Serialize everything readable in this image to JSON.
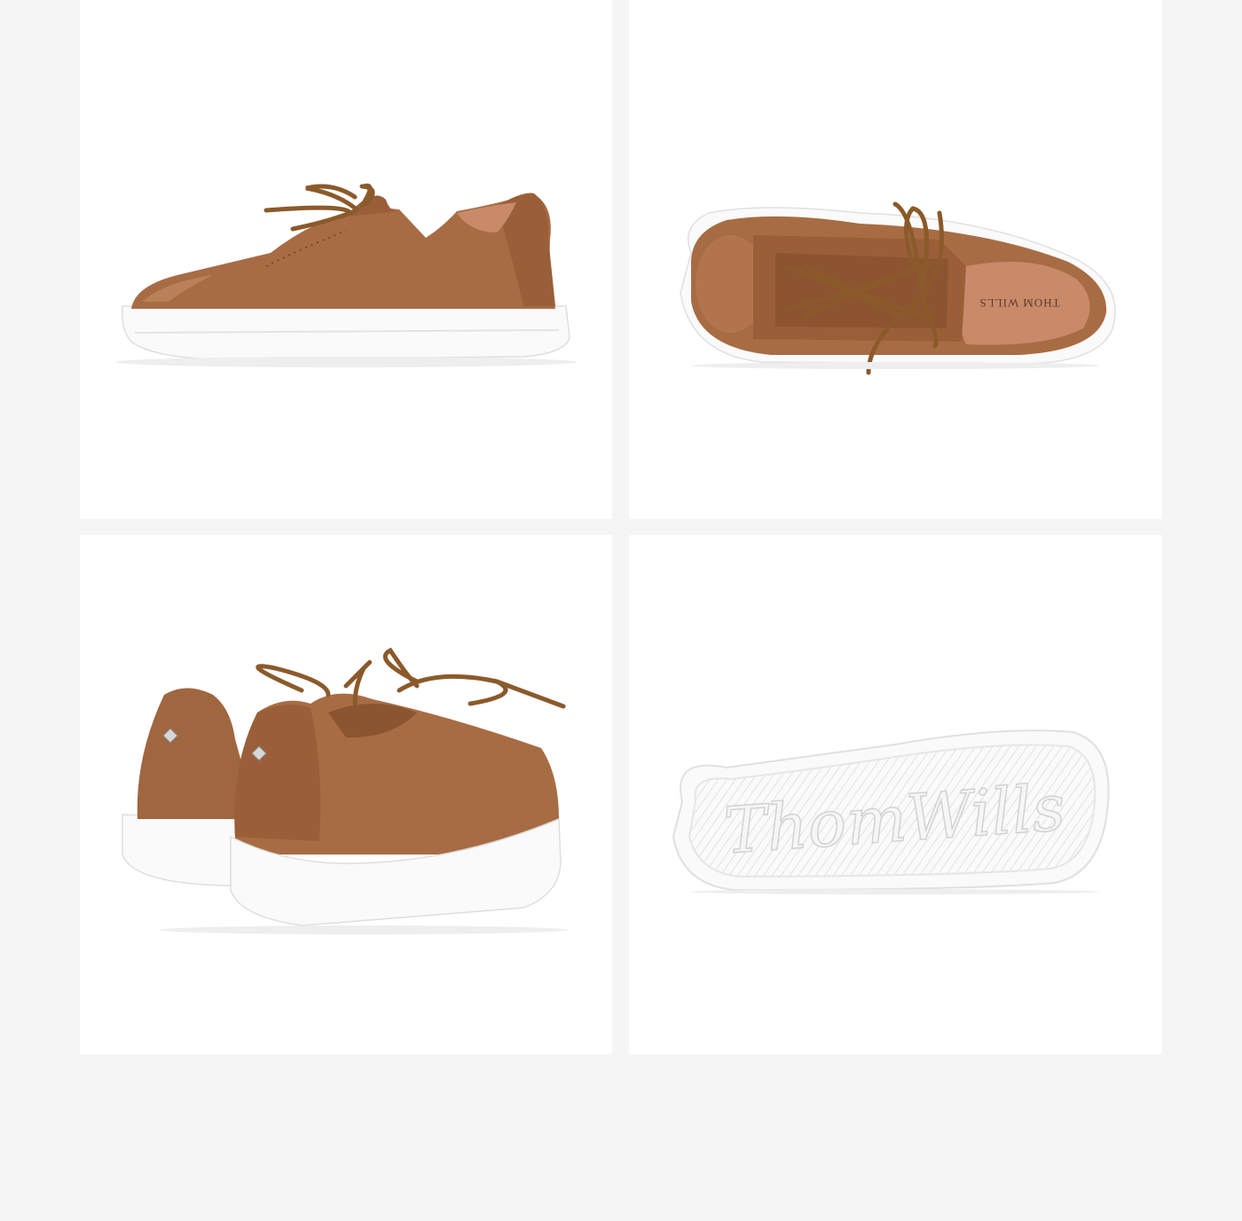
{
  "colors": {
    "page_background": "#f5f5f5",
    "tile_background": "#ffffff",
    "leather": "#a86c44",
    "leather_dark": "#8a5530",
    "leather_light": "#c08a62",
    "lace": "#8b5a2b",
    "sole": "#fafafa",
    "sole_shadow": "#e4e4e4",
    "lining": "#c98a6a"
  },
  "gallery": {
    "images": [
      {
        "id": "side",
        "alt": "Tan pebbled leather sneaker, side view"
      },
      {
        "id": "top",
        "alt": "Tan pebbled leather sneaker, top view"
      },
      {
        "id": "back",
        "alt": "Pair of tan leather sneakers, rear view"
      },
      {
        "id": "sole",
        "alt": "White rubber outsole with embossed logo"
      }
    ]
  },
  "brand": {
    "insole_print": "THOM WILLS",
    "outsole_emboss": "ThomWills"
  }
}
